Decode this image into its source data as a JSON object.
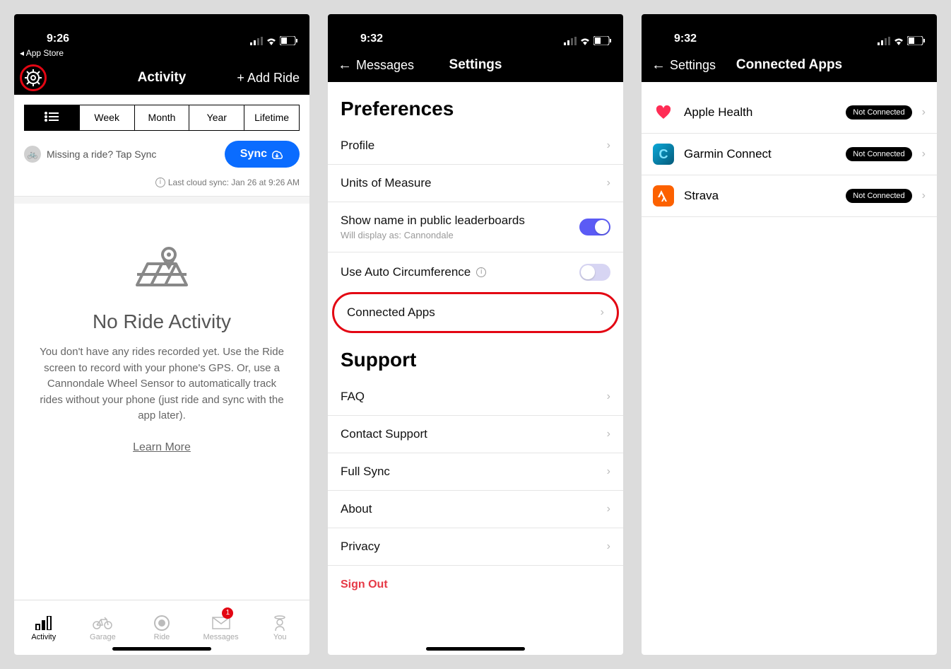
{
  "screen1": {
    "status": {
      "time": "9:26",
      "back_app": "◂ App Store"
    },
    "nav": {
      "title": "Activity",
      "add_ride": "+ Add Ride"
    },
    "segments": {
      "list": "≡",
      "week": "Week",
      "month": "Month",
      "year": "Year",
      "lifetime": "Lifetime"
    },
    "missing": "Missing a ride? Tap Sync",
    "sync_btn": "Sync",
    "last_sync": "Last cloud sync: Jan 26 at 9:26 AM",
    "empty": {
      "title": "No Ride Activity",
      "body": "You don't have any rides recorded yet. Use the Ride screen to record with your phone's GPS. Or, use a Cannondale Wheel Sensor to automatically track rides without your phone (just ride and sync with the app later).",
      "learn": "Learn More"
    },
    "tabs": {
      "activity": "Activity",
      "garage": "Garage",
      "ride": "Ride",
      "messages": "Messages",
      "you": "You",
      "badge": "1"
    }
  },
  "screen2": {
    "status": {
      "time": "9:32"
    },
    "nav": {
      "back": "Messages",
      "title": "Settings"
    },
    "preferences_heading": "Preferences",
    "rows": {
      "profile": "Profile",
      "units": "Units of Measure",
      "leaderboards": "Show name in public leaderboards",
      "leaderboards_sub": "Will display as: Cannondale",
      "auto_circ": "Use Auto Circumference",
      "connected": "Connected Apps"
    },
    "support_heading": "Support",
    "support": {
      "faq": "FAQ",
      "contact": "Contact Support",
      "fullsync": "Full Sync",
      "about": "About",
      "privacy": "Privacy"
    },
    "sign_out": "Sign Out"
  },
  "screen3": {
    "status": {
      "time": "9:32"
    },
    "nav": {
      "back": "Settings",
      "title": "Connected Apps"
    },
    "apps": {
      "health": {
        "name": "Apple Health",
        "status": "Not Connected"
      },
      "garmin": {
        "name": "Garmin Connect",
        "status": "Not Connected"
      },
      "strava": {
        "name": "Strava",
        "status": "Not Connected"
      }
    }
  }
}
